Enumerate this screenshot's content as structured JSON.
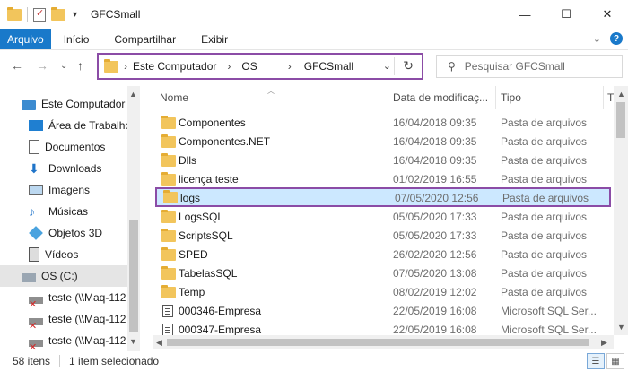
{
  "window": {
    "title": "GFCSmall",
    "minimize_icon": "—",
    "maximize_icon": "☐",
    "close_icon": "✕"
  },
  "ribbon": {
    "tabs": [
      "Arquivo",
      "Início",
      "Compartilhar",
      "Exibir"
    ]
  },
  "nav": {
    "breadcrumbs": [
      "Este Computador",
      "OS",
      "GFCSmall"
    ],
    "search_placeholder": "Pesquisar GFCSmall"
  },
  "sidebar": {
    "items": [
      {
        "label": "Este Computador",
        "icon": "computer-icon"
      },
      {
        "label": "Área de Trabalho",
        "icon": "desktop-icon"
      },
      {
        "label": "Documentos",
        "icon": "documents-icon"
      },
      {
        "label": "Downloads",
        "icon": "downloads-icon"
      },
      {
        "label": "Imagens",
        "icon": "pictures-icon"
      },
      {
        "label": "Músicas",
        "icon": "music-icon"
      },
      {
        "label": "Objetos 3D",
        "icon": "objects3d-icon"
      },
      {
        "label": "Vídeos",
        "icon": "videos-icon"
      },
      {
        "label": "OS (C:)",
        "icon": "drive-icon"
      },
      {
        "label": "teste (\\\\Maq-112",
        "icon": "network-drive-icon"
      },
      {
        "label": "teste (\\\\Maq-112",
        "icon": "network-drive-icon"
      },
      {
        "label": "teste (\\\\Maq-112",
        "icon": "network-drive-icon"
      }
    ]
  },
  "columns": {
    "name": "Nome",
    "date": "Data de modificaç...",
    "type": "Tipo",
    "extra": "T"
  },
  "files": [
    {
      "name": "Componentes",
      "date": "16/04/2018 09:35",
      "type": "Pasta de arquivos",
      "kind": "folder"
    },
    {
      "name": "Componentes.NET",
      "date": "16/04/2018 09:35",
      "type": "Pasta de arquivos",
      "kind": "folder"
    },
    {
      "name": "Dlls",
      "date": "16/04/2018 09:35",
      "type": "Pasta de arquivos",
      "kind": "folder"
    },
    {
      "name": "licença teste",
      "date": "01/02/2019 16:55",
      "type": "Pasta de arquivos",
      "kind": "folder"
    },
    {
      "name": "logs",
      "date": "07/05/2020 12:56",
      "type": "Pasta de arquivos",
      "kind": "folder"
    },
    {
      "name": "LogsSQL",
      "date": "05/05/2020 17:33",
      "type": "Pasta de arquivos",
      "kind": "folder"
    },
    {
      "name": "ScriptsSQL",
      "date": "05/05/2020 17:33",
      "type": "Pasta de arquivos",
      "kind": "folder"
    },
    {
      "name": "SPED",
      "date": "26/02/2020 12:56",
      "type": "Pasta de arquivos",
      "kind": "folder"
    },
    {
      "name": "TabelasSQL",
      "date": "07/05/2020 13:08",
      "type": "Pasta de arquivos",
      "kind": "folder"
    },
    {
      "name": "Temp",
      "date": "08/02/2019 12:02",
      "type": "Pasta de arquivos",
      "kind": "folder"
    },
    {
      "name": "000346-Empresa",
      "date": "22/05/2019 16:08",
      "type": "Microsoft SQL Ser...",
      "kind": "file"
    },
    {
      "name": "000347-Empresa",
      "date": "22/05/2019 16:08",
      "type": "Microsoft SQL Ser...",
      "kind": "file"
    }
  ],
  "status": {
    "item_count": "58 itens",
    "selection": "1 item selecionado"
  }
}
